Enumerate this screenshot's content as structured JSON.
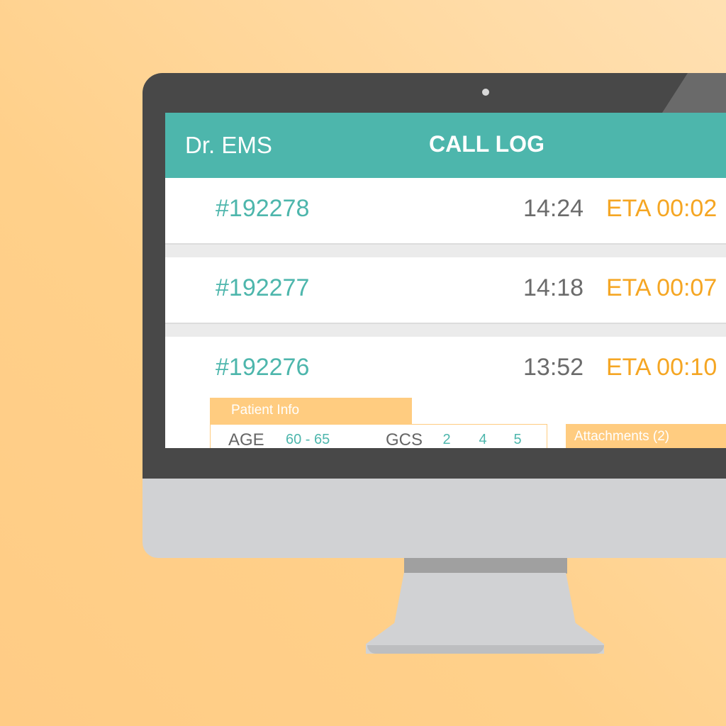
{
  "header": {
    "brand": "Dr. EMS",
    "title": "CALL LOG"
  },
  "calls": [
    {
      "id": "#192278",
      "time": "14:24",
      "eta": "ETA 00:02"
    },
    {
      "id": "#192277",
      "time": "14:18",
      "eta": "ETA 00:07"
    },
    {
      "id": "#192276",
      "time": "13:52",
      "eta": "ETA 00:10"
    }
  ],
  "patient_info": {
    "tab_label": "Patient Info",
    "age_label": "AGE",
    "age_value": "60 - 65",
    "gcs_label": "GCS",
    "gcs_values": [
      "2",
      "4",
      "5"
    ]
  },
  "attachments": {
    "label": "Attachments (2)"
  },
  "colors": {
    "accent": "#4db6ac",
    "eta": "#f5a623",
    "panel": "#ffcc80",
    "background": "#ffd08a"
  }
}
